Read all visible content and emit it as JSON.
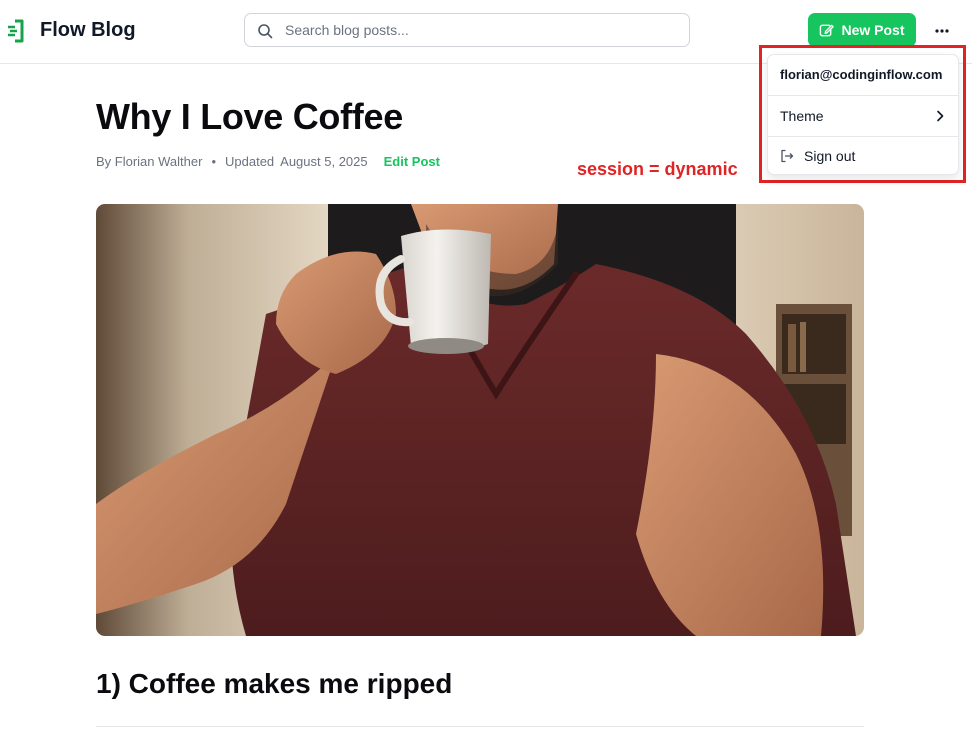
{
  "app": {
    "brand": "Flow Blog"
  },
  "header": {
    "search_placeholder": "Search blog posts...",
    "new_post_label": "New Post",
    "more_icon": "ellipsis-icon"
  },
  "user_menu": {
    "email": "florian@codinginflow.com",
    "items": [
      {
        "label": "Theme",
        "icon": "chevron-right-icon"
      },
      {
        "label": "Sign out",
        "icon": "sign-out-icon"
      }
    ]
  },
  "annotation": {
    "text": "session = dynamic",
    "color": "#e02424"
  },
  "post": {
    "title": "Why I Love Coffee",
    "author": "By Florian Walther",
    "separator": "•",
    "updated_label": "Updated",
    "updated_date": "August 5, 2025",
    "edit_label": "Edit Post",
    "image_alt": "Muscular man in maroon t-shirt drinking from a white coffee mug",
    "section_heading": "1) Coffee makes me ripped"
  },
  "colors": {
    "accent": "#16c55d",
    "text": "#111827",
    "muted": "#6b7280",
    "border": "#e5e7eb"
  }
}
